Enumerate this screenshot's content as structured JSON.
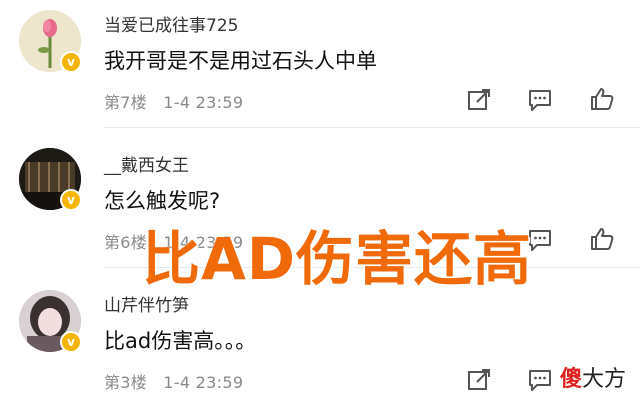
{
  "comments": [
    {
      "username": "当爱已成往事725",
      "text": "我开哥是不是用过石头人中单",
      "floor": "第7楼",
      "date": "1-4 23:59",
      "badge": "v"
    },
    {
      "username": "__戴西女王",
      "text": "怎么触发呢?",
      "floor": "第6楼",
      "date": "1-4 23:59",
      "badge": "v"
    },
    {
      "username": "山芹伴竹笋",
      "text": "比ad伤害高。。。",
      "floor": "第3楼",
      "date": "1-4 23:59",
      "badge": "v"
    }
  ],
  "overlay_caption": "比AD伤害还高",
  "watermark": {
    "accent": "傻",
    "rest": "大方"
  },
  "icons": [
    "edit-icon",
    "comment-icon",
    "like-icon"
  ],
  "colors": {
    "overlay": "#f06a0a",
    "badge": "#f7b500",
    "meta": "#8a8a8a"
  }
}
